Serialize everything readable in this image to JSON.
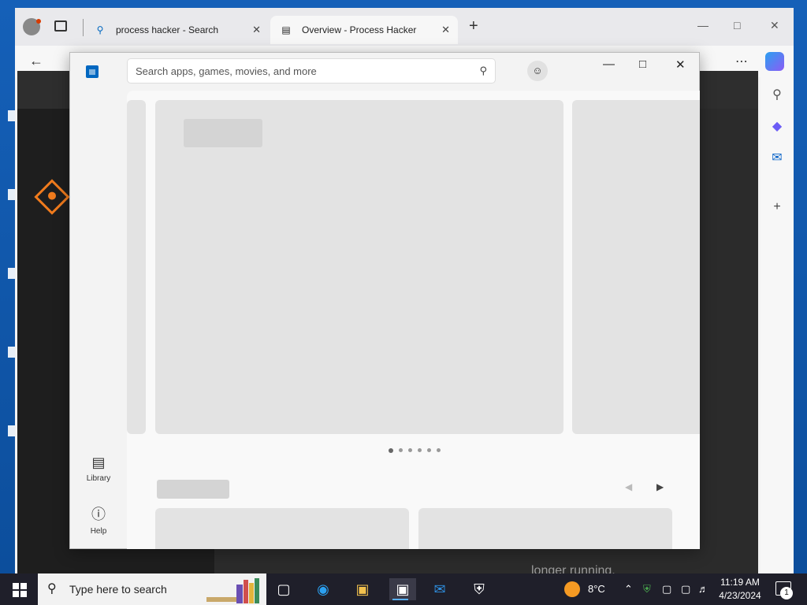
{
  "browser": {
    "tabs": [
      {
        "label": "process hacker - Search",
        "icon": "search-icon"
      },
      {
        "label": "Overview - Process Hacker",
        "icon": "process-hacker-icon"
      }
    ],
    "new_tab": "+",
    "content_footer": "longer running."
  },
  "store": {
    "search_placeholder": "Search apps, games, movies, and more",
    "nav": [
      {
        "label": "Library",
        "icon": "library-icon"
      },
      {
        "label": "Help",
        "icon": "help-icon"
      }
    ]
  },
  "taskbar": {
    "search_placeholder": "Type here to search",
    "weather": "8°C",
    "time": "11:19 AM",
    "date": "4/23/2024",
    "notifications": "1"
  },
  "colors": {
    "accent": "#0067c0",
    "taskbar": "#1f1f2a",
    "desktop": "#1560b8",
    "logo": "#f07b1d"
  }
}
